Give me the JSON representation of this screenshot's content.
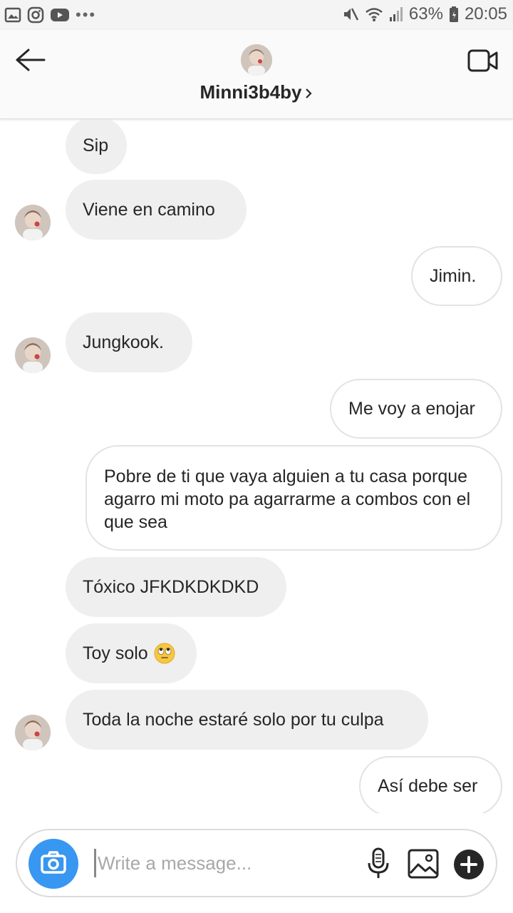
{
  "status_bar": {
    "battery": "63%",
    "time": "20:05",
    "icons_left": [
      "gallery-icon",
      "instagram-icon",
      "youtube-icon",
      "more-icon"
    ],
    "icons_right": [
      "mute-icon",
      "wifi-icon",
      "signal-icon",
      "battery-icon"
    ]
  },
  "header": {
    "username": "Minni3b4by",
    "back_icon": "arrow-left-icon",
    "video_icon": "video-camera-icon"
  },
  "messages": [
    {
      "side": "in",
      "text": "Sip",
      "avatar": false
    },
    {
      "side": "in",
      "text": "Viene en camino",
      "avatar": true
    },
    {
      "side": "out",
      "text": "Jimin."
    },
    {
      "side": "in",
      "text": "Jungkook.",
      "avatar": true
    },
    {
      "side": "out",
      "text": "Me voy a enojar"
    },
    {
      "side": "out",
      "text": "Pobre de ti que vaya alguien a tu casa porque agarro mi moto pa agarrarme a combos con el que sea"
    },
    {
      "side": "in",
      "text": "Tóxico JFKDKDKDKD",
      "avatar": false
    },
    {
      "side": "in",
      "text": "Toy solo",
      "emoji": "face-with-rolling-eyes-emoji",
      "avatar": false
    },
    {
      "side": "in",
      "text": "Toda la noche estaré solo por tu culpa",
      "avatar": true
    },
    {
      "side": "out",
      "text": "Así debe ser"
    }
  ],
  "composer": {
    "placeholder": "Write a message...",
    "value": "",
    "icons": [
      "camera-icon",
      "microphone-icon",
      "image-icon",
      "plus-icon"
    ]
  },
  "colors": {
    "accent": "#3897f0",
    "incoming_bubble": "#efefef",
    "outgoing_border": "#e3e3e3",
    "statusbar": "#f4f4f4"
  }
}
